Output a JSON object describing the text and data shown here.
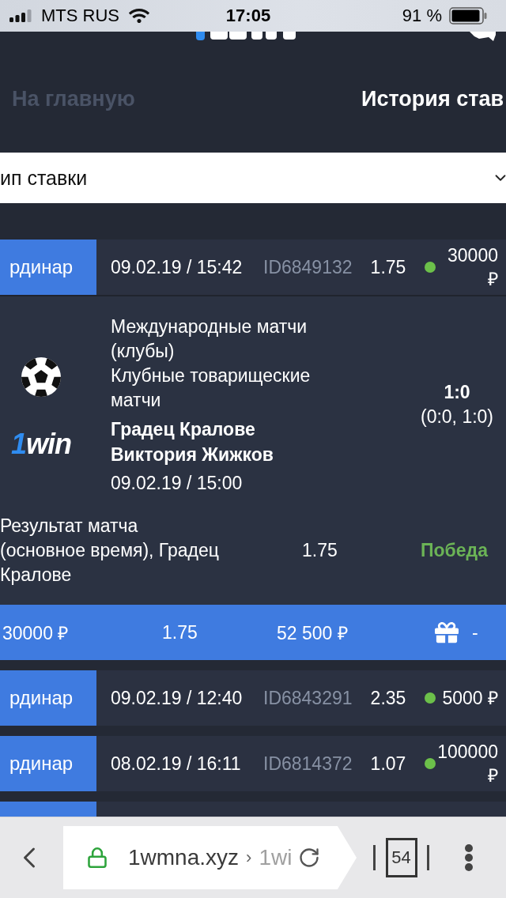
{
  "status_bar": {
    "carrier": "MTS RUS",
    "time": "17:05",
    "battery": "91 %"
  },
  "header": {
    "nav": [
      {
        "label": "На главную",
        "selected": false
      },
      {
        "label": "История став",
        "selected": true
      }
    ]
  },
  "filter": {
    "value": "ип ставки"
  },
  "bets": [
    {
      "kind": "expanded",
      "type": "рдинар",
      "datetime": "09.02.19 / 15:42",
      "id": "ID6849132",
      "odds": "1.75",
      "color": "#6cc04a",
      "amount": "30000 ₽",
      "event": {
        "tournament": "Международные матчи (клубы)",
        "league": "Клубные товарищеские матчи",
        "teams": [
          "Градец Кралове",
          "Виктория Жижков"
        ],
        "start": "09.02.19 / 15:00",
        "score": "1:0",
        "periods": "(0:0, 1:0)",
        "logo": {
          "prefix": "1",
          "name": "win"
        }
      },
      "selection": {
        "market": "Результат матча (основное время), Градец Кралове",
        "odds": "1.75",
        "result": "Победа"
      },
      "summary": {
        "stake": "30000 ₽",
        "odds": "1.75",
        "payout": "52 500 ₽",
        "bonus": "-"
      }
    },
    {
      "kind": "collapsed",
      "type": "рдинар",
      "datetime": "09.02.19 / 12:40",
      "id": "ID6843291",
      "odds": "2.35",
      "color": "#6cc04a",
      "amount": "5000 ₽"
    },
    {
      "kind": "collapsed",
      "type": "рдинар",
      "datetime": "08.02.19 / 16:11",
      "id": "ID6814372",
      "odds": "1.07",
      "color": "#6cc04a",
      "amount": "100000 ₽"
    },
    {
      "kind": "cut"
    }
  ],
  "browser_bar": {
    "domain": "1wmna.xyz",
    "separator": "›",
    "path": "1wi",
    "tab_count": "54"
  }
}
